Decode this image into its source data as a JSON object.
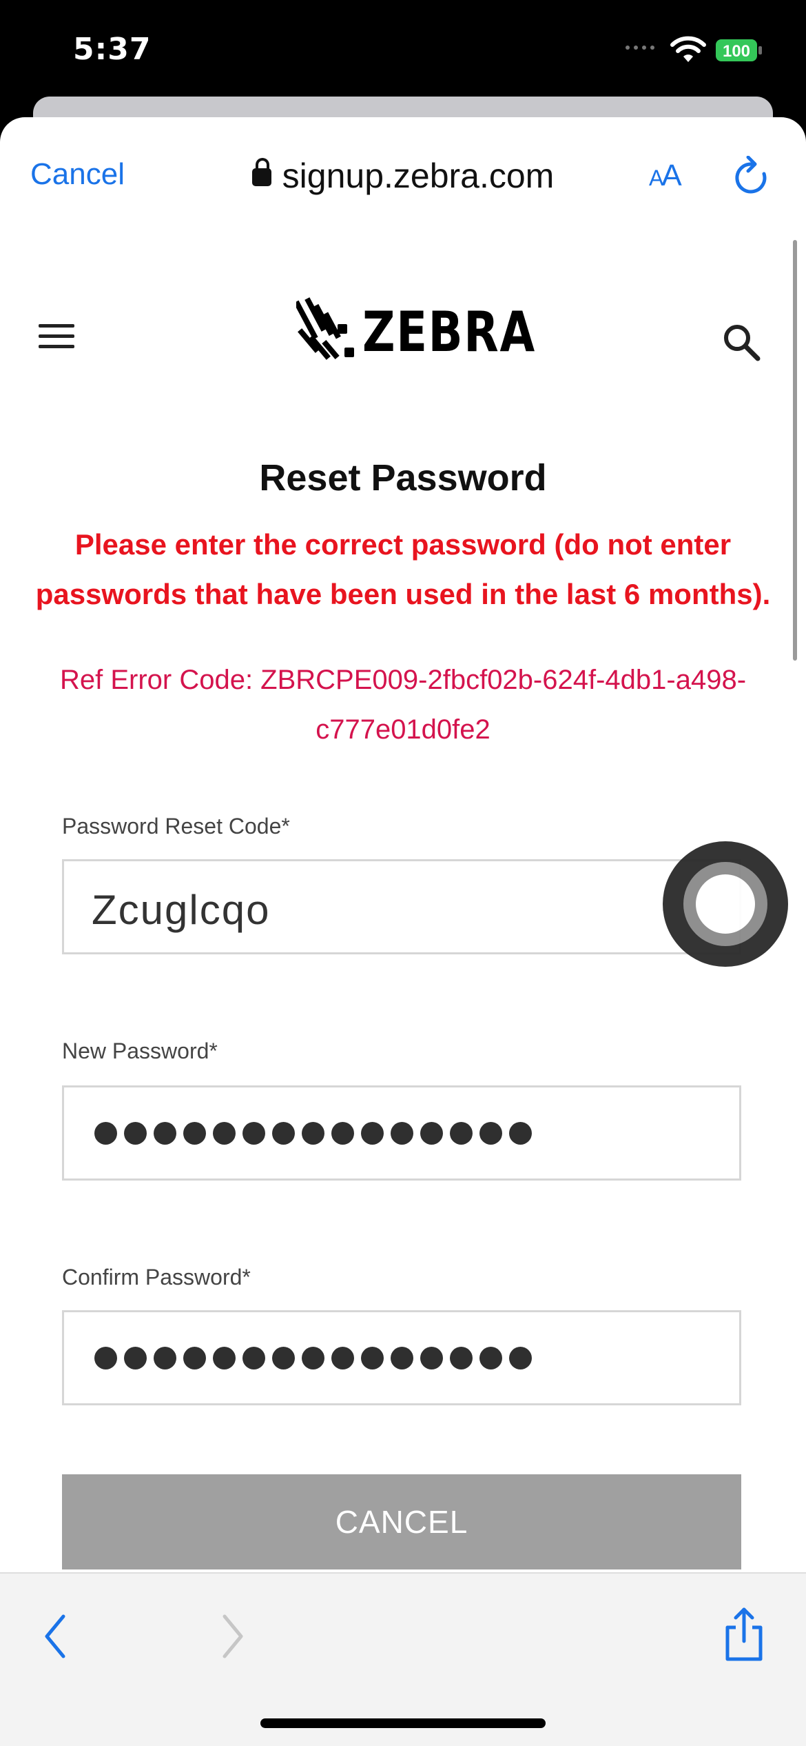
{
  "status_bar": {
    "time": "5:37",
    "battery": "100"
  },
  "browser_nav": {
    "cancel_label": "Cancel",
    "url": "signup.zebra.com",
    "text_size_label": "AA"
  },
  "site_header": {
    "logo_text": "ZEBRA"
  },
  "page": {
    "title": "Reset Password",
    "error_message": "Please enter the correct password (do not enter passwords that have been used in the last 6 months).",
    "ref_error": "Ref Error Code: ZBRCPE009-2fbcf02b-624f-4db1-a498-c777e01d0fe2"
  },
  "form": {
    "reset_code_label": "Password Reset Code*",
    "reset_code_value": "Zcuglcqo",
    "new_password_label": "New Password*",
    "new_password_masked_count": 15,
    "confirm_password_label": "Confirm Password*",
    "confirm_password_masked_count": 15,
    "cancel_button": "CANCEL"
  },
  "colors": {
    "link_blue": "#1a73e8",
    "error_red": "#e8141f",
    "ref_red": "#d4134d",
    "button_gray": "#a0a0a0",
    "battery_green": "#34c759"
  },
  "icons": [
    "lock-icon",
    "reload-icon",
    "menu-icon",
    "search-icon",
    "back-icon",
    "forward-icon",
    "share-icon",
    "wifi-icon",
    "battery-icon"
  ]
}
